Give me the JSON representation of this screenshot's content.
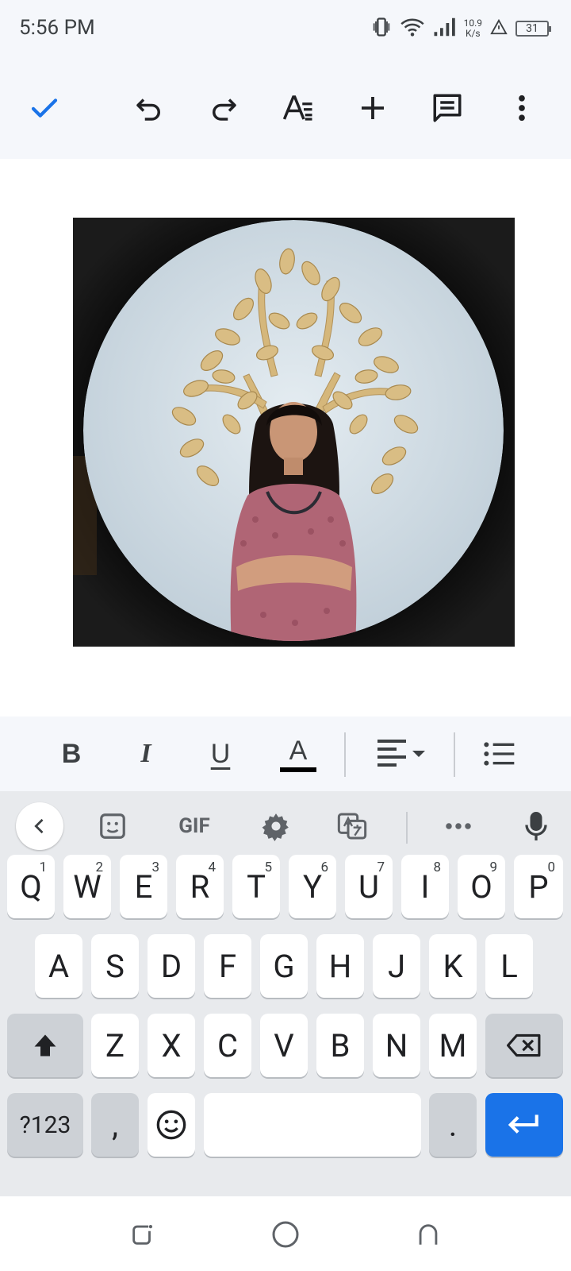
{
  "status_bar": {
    "time": "5:56 PM",
    "speed_value": "10.9",
    "speed_unit": "K/s",
    "battery": "31"
  },
  "toolbar": {
    "icons": [
      "check-icon",
      "undo-icon",
      "redo-icon",
      "text-format-icon",
      "add-icon",
      "comment-icon",
      "more-vert-icon"
    ],
    "accent": "#1a73e8"
  },
  "document": {
    "image": "circular portrait photo: woman in pink dress with arms crossed in front of golden tree-of-life wall art"
  },
  "format_bar": {
    "bold": "B",
    "italic": "I",
    "underline": "U",
    "text_color": "A"
  },
  "keyboard": {
    "suggestion_gif": "GIF",
    "row1": [
      "Q",
      "W",
      "E",
      "R",
      "T",
      "Y",
      "U",
      "I",
      "O",
      "P"
    ],
    "row1_hints": [
      "1",
      "2",
      "3",
      "4",
      "5",
      "6",
      "7",
      "8",
      "9",
      "0"
    ],
    "row2": [
      "A",
      "S",
      "D",
      "F",
      "G",
      "H",
      "J",
      "K",
      "L"
    ],
    "row3": [
      "Z",
      "X",
      "C",
      "V",
      "B",
      "N",
      "M"
    ],
    "symbols": "?123",
    "comma": ",",
    "period": "."
  },
  "colors": {
    "background": "#f5f7fb",
    "keyboard": "#e8eaed",
    "enter": "#1a73e8"
  }
}
